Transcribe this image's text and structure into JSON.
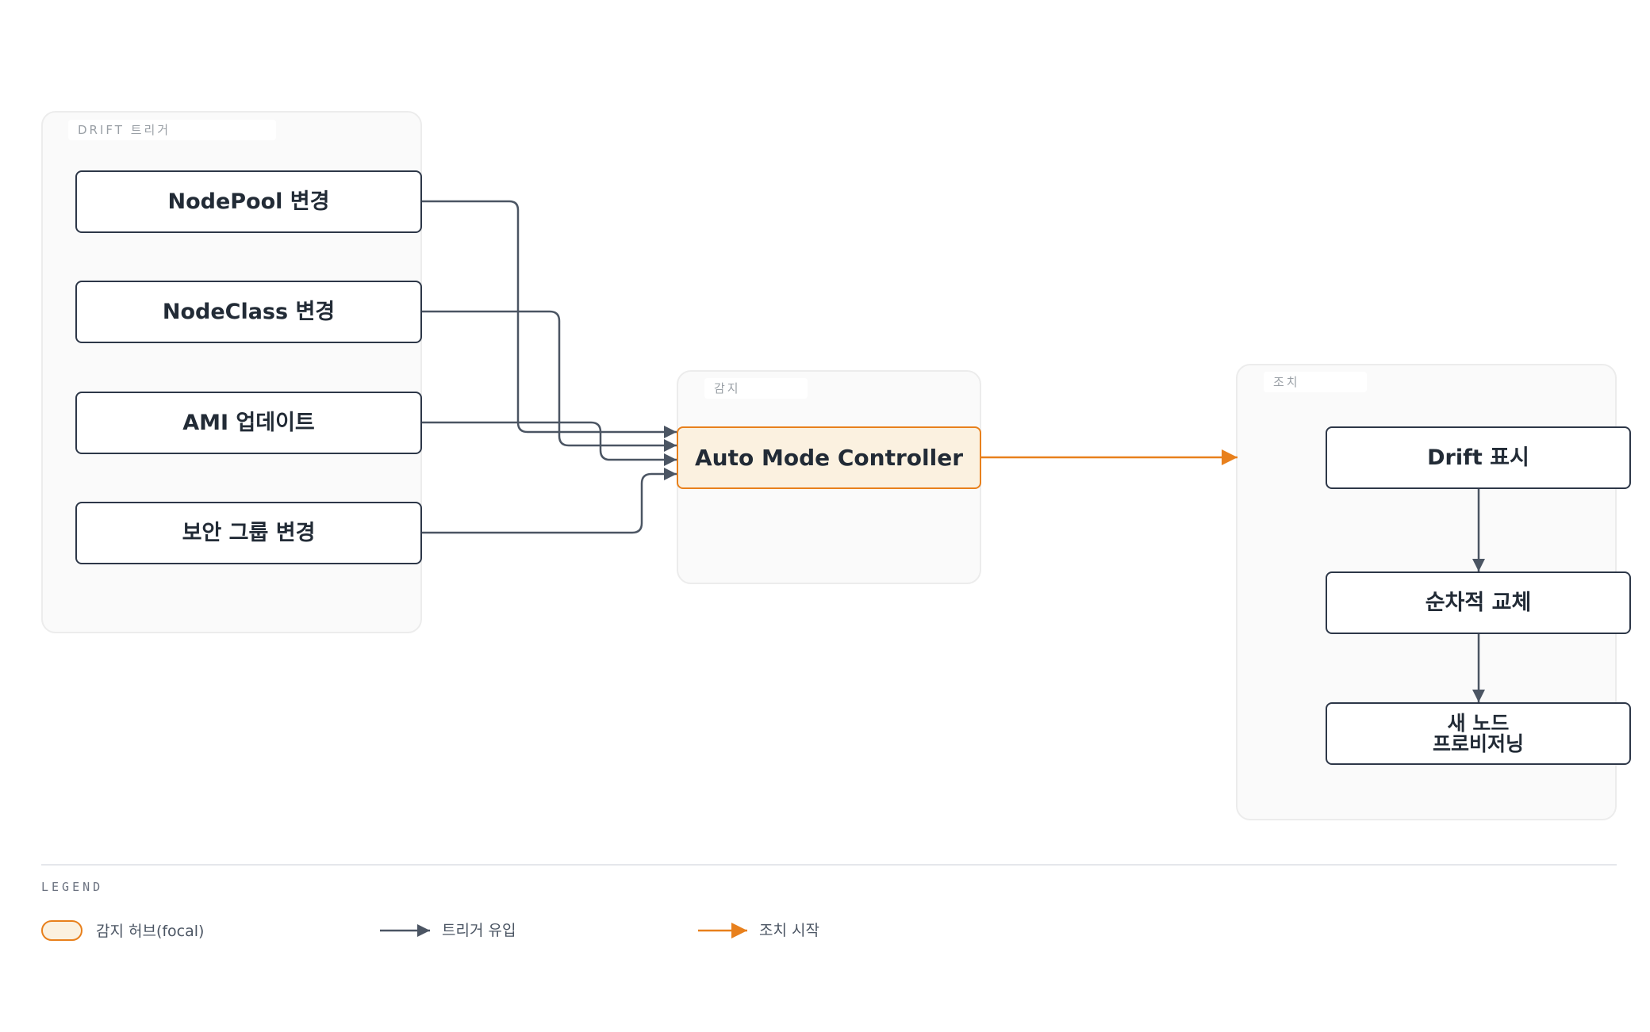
{
  "groups": {
    "triggers": "DRIFT 트리거",
    "detect": "감지",
    "action": "조치"
  },
  "nodes": {
    "nodepool": "NodePool 변경",
    "nodeclass": "NodeClass 변경",
    "ami": "AMI 업데이트",
    "security_group": "보안 그룹 변경",
    "controller": "Auto Mode Controller",
    "drift_mark_line1": "Drift 표시",
    "rolling_replace": "순차적 교체",
    "provision_line1": "새 노드",
    "provision_line2": "프로비저닝"
  },
  "legend": {
    "title": "LEGEND",
    "hub": "감지 허브(focal)",
    "trigger_flow": "트리거 유입",
    "action_start": "조치 시작"
  },
  "colors": {
    "accent": "#e8801c",
    "edge": "#4b5563",
    "node_border": "#2d3748",
    "focal_fill": "#fbf1e0"
  }
}
